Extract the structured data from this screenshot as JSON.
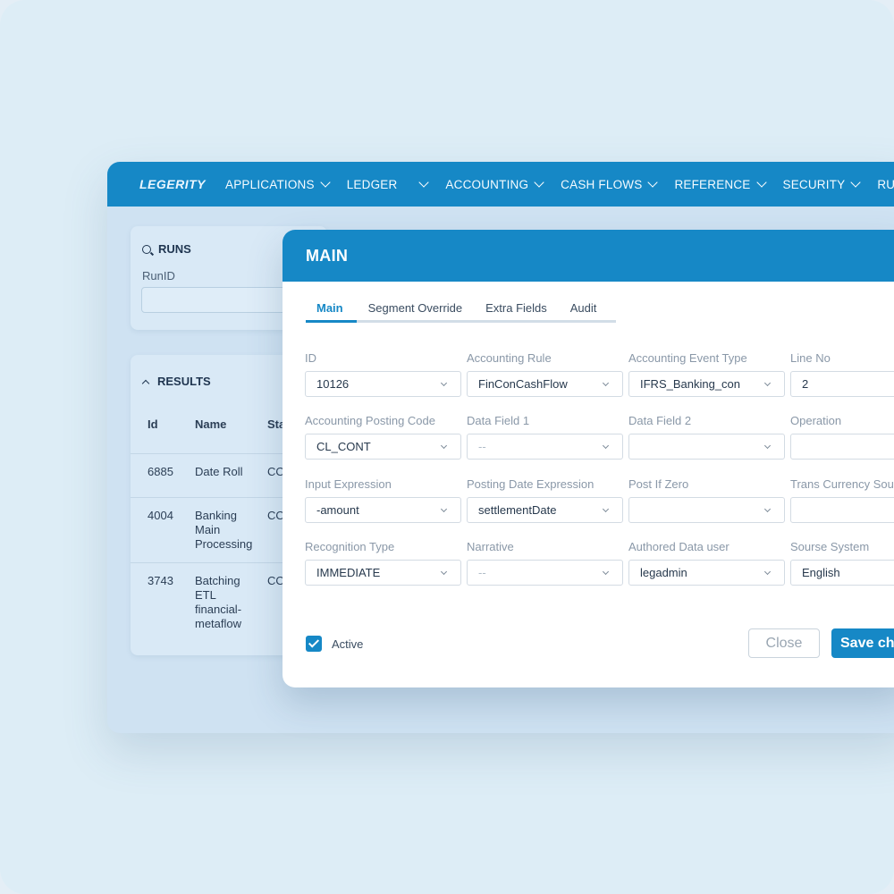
{
  "nav": {
    "logo": "LEGERITY",
    "items": [
      "APPLICATIONS",
      "LEDGER",
      "ACCOUNTING",
      "CASH FLOWS",
      "REFERENCE",
      "SECURITY",
      "RUN"
    ]
  },
  "runs": {
    "title": "RUNS",
    "runid_label": "RunID",
    "runid_value": ""
  },
  "results": {
    "title": "RESULTS",
    "columns": [
      "Id",
      "Name",
      "Sta"
    ],
    "rows": [
      {
        "id": "6885",
        "name": "Date Roll",
        "status": "CO"
      },
      {
        "id": "4004",
        "name": "Banking\nMain\nProcessing",
        "status": "CO"
      },
      {
        "id": "3743",
        "name": "Batching\nETL\nfinancial-\nmetaflow",
        "status": "CO"
      }
    ]
  },
  "modal": {
    "title": "MAIN",
    "tabs": [
      "Main",
      "Segment Override",
      "Extra Fields",
      "Audit"
    ],
    "active_tab": "Main",
    "fields": [
      {
        "label": "ID",
        "value": "10126",
        "dropdown": true
      },
      {
        "label": "Accounting Rule",
        "value": "FinConCashFlow",
        "dropdown": true
      },
      {
        "label": "Accounting Event Type",
        "value": "IFRS_Banking_con",
        "dropdown": true
      },
      {
        "label": "Line No",
        "value": "2",
        "dropdown": false
      },
      {
        "label": "Accounting Posting Code",
        "value": "CL_CONT",
        "dropdown": true
      },
      {
        "label": "Data Field 1",
        "value": "--",
        "dropdown": true,
        "placeholder": true
      },
      {
        "label": "Data Field 2",
        "value": "",
        "dropdown": true
      },
      {
        "label": "Operation",
        "value": "",
        "dropdown": false
      },
      {
        "label": "Input Expression",
        "value": "-amount",
        "dropdown": true
      },
      {
        "label": "Posting Date Expression",
        "value": "settlementDate",
        "dropdown": true
      },
      {
        "label": "Post If Zero",
        "value": "",
        "dropdown": true
      },
      {
        "label": "Trans Currency Sou",
        "value": "",
        "dropdown": false
      },
      {
        "label": "Recognition Type",
        "value": "IMMEDIATE",
        "dropdown": true
      },
      {
        "label": "Narrative",
        "value": "--",
        "dropdown": true,
        "placeholder": true
      },
      {
        "label": "Authored Data user",
        "value": "legadmin",
        "dropdown": true
      },
      {
        "label": "Sourse System",
        "value": "English",
        "dropdown": false
      }
    ],
    "active_label": "Active",
    "active_checked": true,
    "close_label": "Close",
    "save_label": "Save ch"
  },
  "colors": {
    "primary": "#1688c6",
    "background": "#ddedf6",
    "panel": "#d9e9f6"
  }
}
